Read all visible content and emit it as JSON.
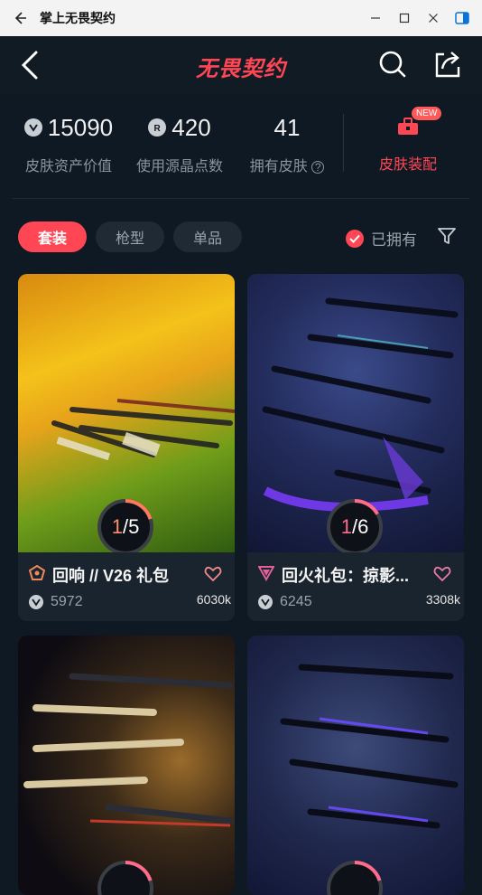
{
  "window": {
    "title": "掌上无畏契约"
  },
  "header": {
    "logo": "无畏契约"
  },
  "stats": {
    "asset_value": "15090",
    "asset_label": "皮肤资产价值",
    "radianite_value": "420",
    "radianite_label": "使用源晶点数",
    "owned_value": "41",
    "owned_label": "拥有皮肤",
    "loadout_label": "皮肤装配",
    "new_badge": "NEW"
  },
  "filters": {
    "chips": [
      "套装",
      "枪型",
      "单品"
    ],
    "active": "套装",
    "owned_label": "已拥有"
  },
  "cards": [
    {
      "name": "回响 // V26 礼包",
      "price": "5972",
      "count": "6030k",
      "progress_cur": "1",
      "progress_total": "5",
      "progress": 0.2
    },
    {
      "name": "回火礼包：掠影...",
      "price": "6245",
      "count": "3308k",
      "progress_cur": "1",
      "progress_total": "6",
      "progress": 0.1667
    },
    {
      "name": "",
      "price": "",
      "count": "",
      "progress_cur": "",
      "progress_total": "",
      "progress": 0.2
    },
    {
      "name": "",
      "price": "",
      "count": "",
      "progress_cur": "",
      "progress_total": "",
      "progress": 0.2
    }
  ],
  "colors": {
    "accent": "#ff4655",
    "background": "#0f1923",
    "card": "#1a242e"
  }
}
